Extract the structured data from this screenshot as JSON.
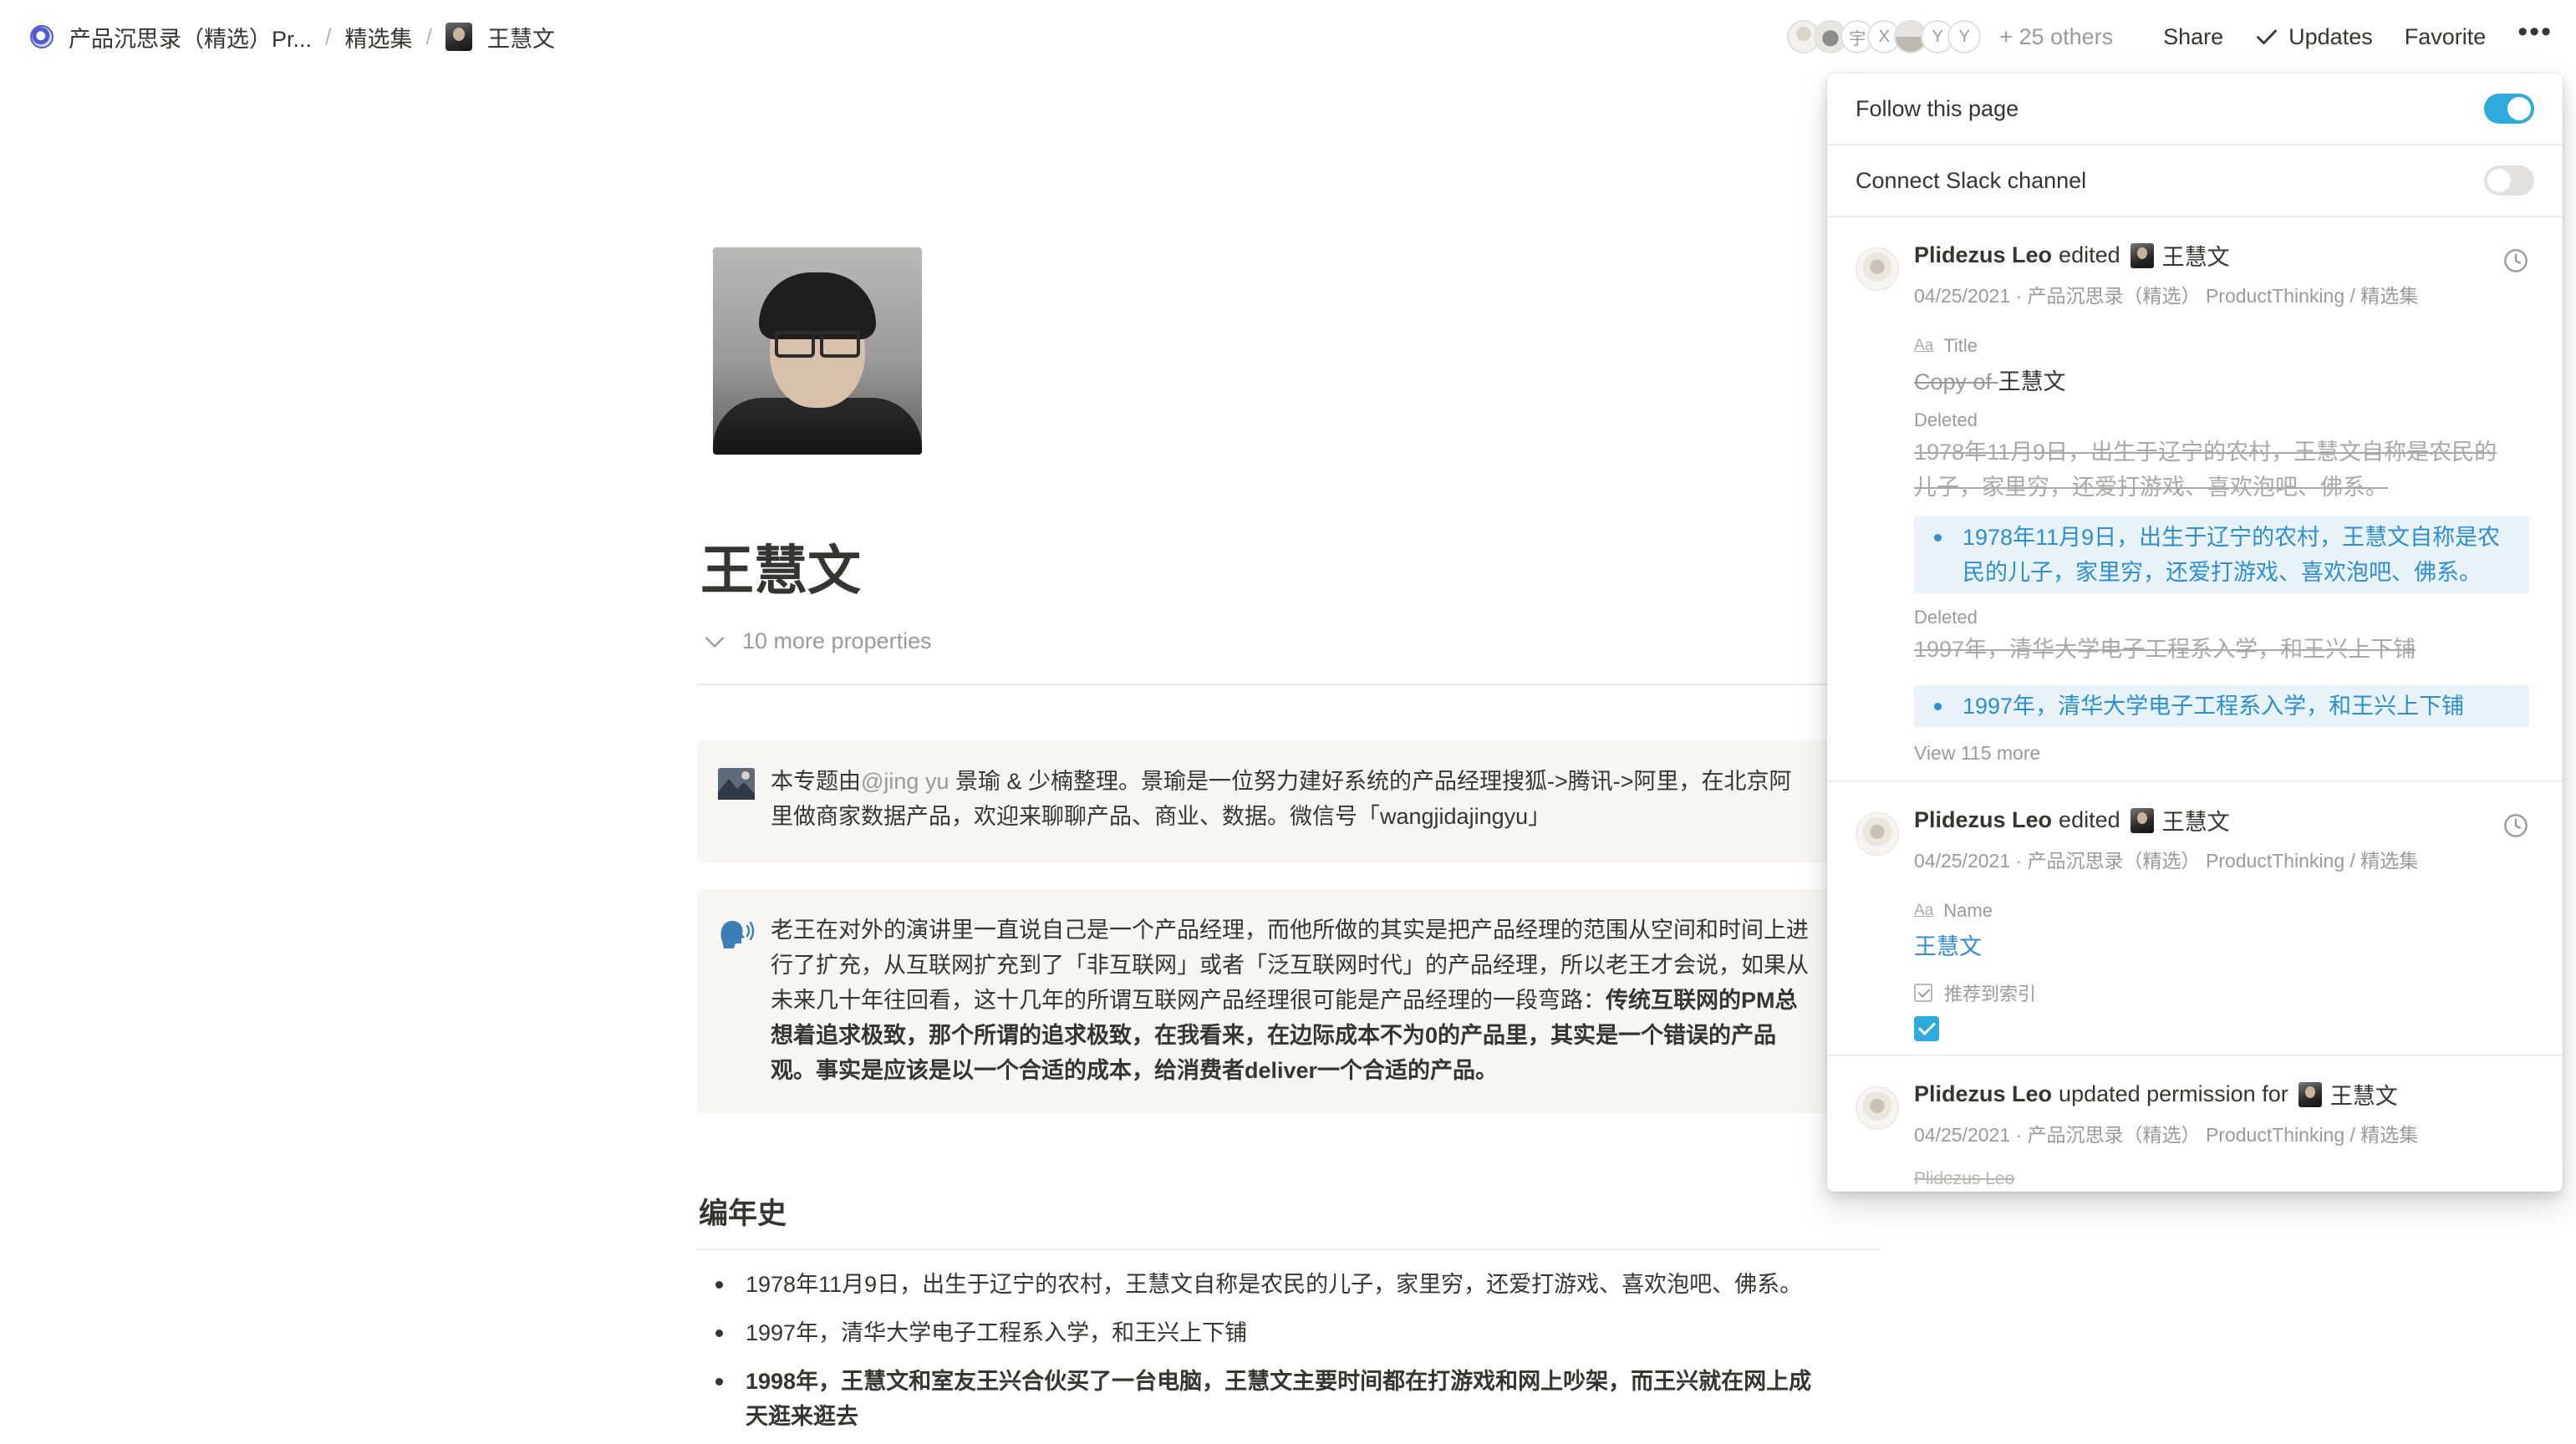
{
  "breadcrumb": {
    "workspace": "产品沉思录（精选）Pr...",
    "collection": "精选集",
    "page": "王慧文",
    "separator": "/"
  },
  "topbar": {
    "avatar_initials": [
      "宇",
      "X",
      "Y",
      "Y"
    ],
    "others": "+ 25 others",
    "share": "Share",
    "updates": "Updates",
    "favorite": "Favorite",
    "more": "•••"
  },
  "page": {
    "title": "王慧文",
    "more_properties": "10 more properties",
    "callout1": {
      "line1_a": "本专题由",
      "mention": "@jing yu",
      "line1_b": " 景瑜 & 少楠整理。景瑜是一位努力建好系统的产品经理搜狐->腾讯->阿里，在北京阿",
      "line2": "里做商家数据产品，欢迎来聊聊产品、商业、数据。微信号「wangjidajingyu」"
    },
    "callout2": {
      "line1": "老王在对外的演讲里一直说自己是一个产品经理，而他所做的其实是把产品经理的范围从空间和时间上进",
      "line2": "行了扩充，从互联网扩充到了「非互联网」或者「泛互联网时代」的产品经理，所以老王才会说，如果从",
      "line3_a": "未来几十年往回看，这十几年的所谓互联网产品经理很可能是产品经理的一段弯路：",
      "line3_b": "传统互联网的PM总",
      "line4": "想着追求极致，那个所谓的追求极致，在我看来，在边际成本不为0的产品里，其实是一个错误的产品",
      "line5": "观。事实是应该是以一个合适的成本，给消费者deliver一个合适的产品。"
    },
    "section_heading": "编年史",
    "bullets": [
      "1978年11月9日，出生于辽宁的农村，王慧文自称是农民的儿子，家里穷，还爱打游戏、喜欢泡吧、佛系。",
      "1997年，清华大学电子工程系入学，和王兴上下铺",
      "1998年，王慧文和室友王兴合伙买了一台电脑，王慧文主要时间都在打游戏和网上吵架，而王兴就在网上成",
      "天逛来逛去"
    ]
  },
  "updates_panel": {
    "follow_label": "Follow this page",
    "follow_on": true,
    "slack_label": "Connect Slack channel",
    "slack_on": false,
    "entries": [
      {
        "user": "Plidezus Leo",
        "action": "edited",
        "target": "王慧文",
        "meta": "04/25/2021 · 产品沉思录（精选） ProductThinking / 精选集",
        "prop_label": "Title",
        "old_prefix": "Copy of ",
        "new_value": "王慧文",
        "deleted_label": "Deleted",
        "deleted_1a": "1978年11月9日，出生于辽宁的农村，王慧文自称是农民的",
        "deleted_1b": "儿子，家里穷，还爱打游戏、喜欢泡吧、佛系。",
        "added_1a": "1978年11月9日，出生于辽宁的农村，王慧文自称是农",
        "added_1b": "民的儿子，家里穷，还爱打游戏、喜欢泡吧、佛系。",
        "deleted_2": "1997年，清华大学电子工程系入学，和王兴上下铺",
        "added_2": "1997年，清华大学电子工程系入学，和王兴上下铺",
        "view_more": "View 115 more"
      },
      {
        "user": "Plidezus Leo",
        "action": "edited",
        "target": "王慧文",
        "meta": "04/25/2021 · 产品沉思录（精选） ProductThinking / 精选集",
        "prop_label": "Name",
        "new_value": "王慧文",
        "checkbox_label": "推荐到索引"
      },
      {
        "user": "Plidezus Leo",
        "action": "updated permission for",
        "target": "王慧文",
        "meta": "04/25/2021 · 产品沉思录（精选） ProductThinking / 精选集",
        "cut_text": "Plidezus Leo"
      }
    ]
  }
}
